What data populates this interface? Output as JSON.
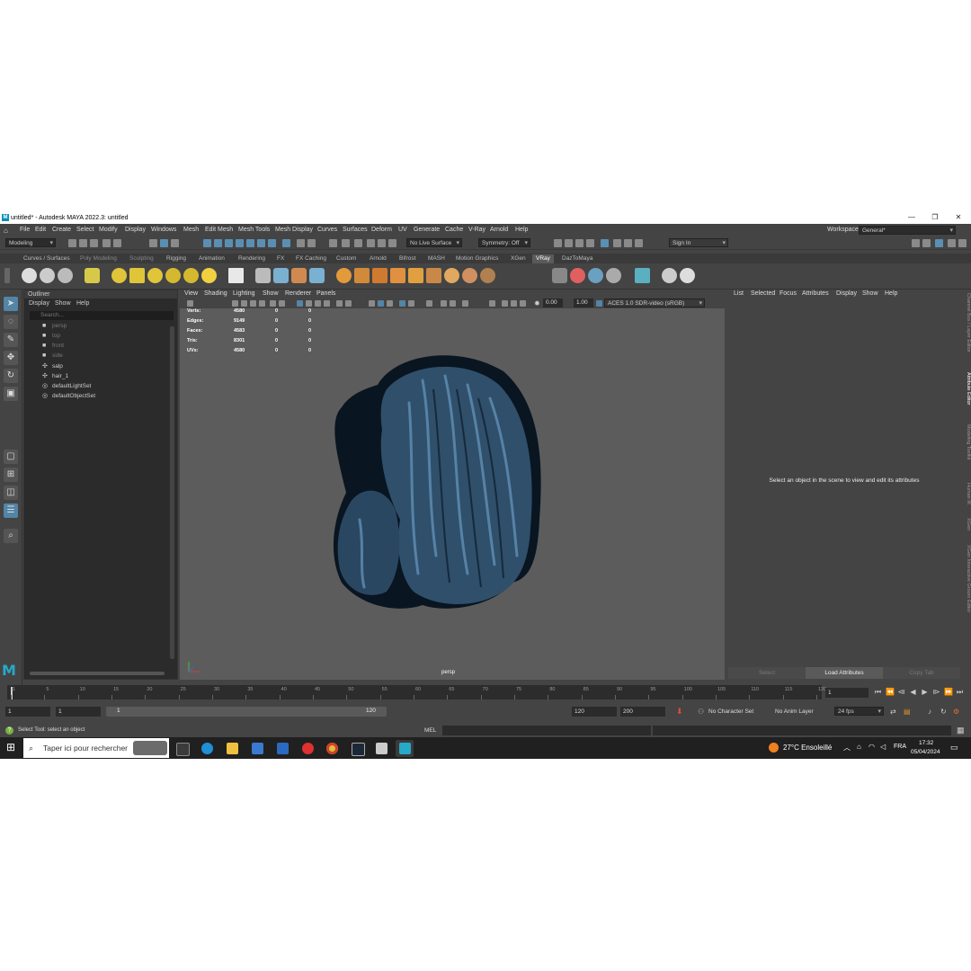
{
  "window": {
    "title": "untitled* - Autodesk MAYA 2022.3: untitled",
    "logo": "M",
    "minimize_icon": "—",
    "restore_icon": "❐",
    "close_icon": "✕"
  },
  "menubar": {
    "items": [
      "File",
      "Edit",
      "Create",
      "Select",
      "Modify",
      "Display",
      "Windows",
      "Mesh",
      "Edit Mesh",
      "Mesh Tools",
      "Mesh Display",
      "Curves",
      "Surfaces",
      "Deform",
      "UV",
      "Generate",
      "Cache",
      "V-Ray",
      "Arnold",
      "Help"
    ],
    "workspace_label": "Workspace:",
    "workspace_value": "General*"
  },
  "statusline": {
    "mode": "Modeling",
    "live_surface": "No Live Surface",
    "symmetry": "Symmetry: Off",
    "sign_in": "Sign In"
  },
  "shelf": {
    "tabs": [
      "Curves / Surfaces",
      "Poly Modeling",
      "Sculpting",
      "Rigging",
      "Animation",
      "Rendering",
      "FX",
      "FX Caching",
      "Custom",
      "Arnold",
      "Bifrost",
      "MASH",
      "Motion Graphics",
      "XGen",
      "VRay",
      "DazToMaya"
    ],
    "active_tab": "VRay"
  },
  "outliner": {
    "title": "Outliner",
    "menu": [
      "Display",
      "Show",
      "Help"
    ],
    "search_placeholder": "Search...",
    "items": [
      {
        "label": "persp",
        "dim": true,
        "icon": "camera-icon"
      },
      {
        "label": "top",
        "dim": true,
        "icon": "camera-icon"
      },
      {
        "label": "front",
        "dim": true,
        "icon": "camera-icon"
      },
      {
        "label": "side",
        "dim": true,
        "icon": "camera-icon"
      },
      {
        "label": "salp",
        "dim": false,
        "icon": "transform-icon"
      },
      {
        "label": "hair_1",
        "dim": false,
        "icon": "transform-icon"
      },
      {
        "label": "defaultLightSet",
        "dim": false,
        "icon": "set-icon"
      },
      {
        "label": "defaultObjectSet",
        "dim": false,
        "icon": "set-icon"
      }
    ]
  },
  "viewport": {
    "menu": [
      "View",
      "Shading",
      "Lighting",
      "Show",
      "Renderer",
      "Panels"
    ],
    "exposure": "0.00",
    "gamma": "1.00",
    "color_space": "ACES 1.0 SDR-video (sRGB)",
    "camera": "persp",
    "hud": [
      {
        "label": "Verts:",
        "v1": "4580",
        "v2": "0",
        "v3": "0"
      },
      {
        "label": "Edges:",
        "v1": "9149",
        "v2": "0",
        "v3": "0"
      },
      {
        "label": "Faces:",
        "v1": "4583",
        "v2": "0",
        "v3": "0"
      },
      {
        "label": "Tris:",
        "v1": "8301",
        "v2": "0",
        "v3": "0"
      },
      {
        "label": "UVs:",
        "v1": "4580",
        "v2": "0",
        "v3": "0"
      }
    ],
    "hair_color": "#3a5c7a"
  },
  "attribute_editor": {
    "menu": [
      "List",
      "Selected",
      "Focus",
      "Attributes",
      "Display",
      "Show",
      "Help"
    ],
    "message": "Select an object in the scene to view and edit its attributes",
    "buttons": [
      "Select",
      "Load Attributes",
      "Copy Tab"
    ]
  },
  "right_tabs": [
    "Channel Box / Layer Editor",
    "Attribute Editor",
    "Modeling Toolkit",
    "Human IK",
    "XGen",
    "XGen Interactive Groom Editor"
  ],
  "timeline": {
    "ticks": [
      "1",
      "5",
      "10",
      "15",
      "20",
      "25",
      "30",
      "35",
      "40",
      "45",
      "50",
      "55",
      "60",
      "65",
      "70",
      "75",
      "80",
      "85",
      "90",
      "95",
      "100",
      "105",
      "110",
      "115",
      "120"
    ],
    "current_frame": "1"
  },
  "range": {
    "start": "1",
    "anim_start": "1",
    "slider_start": "1",
    "slider_end": "120",
    "anim_end": "120",
    "end": "200",
    "character_set": "No Character Set",
    "anim_layer": "No Anim Layer",
    "fps": "24 fps"
  },
  "commandline": {
    "help_text": "Select Tool: select an object",
    "lang": "MEL"
  },
  "taskbar": {
    "search_placeholder": "Taper ici pour rechercher",
    "weather": "27°C  Ensoleillé",
    "lang": "FRA",
    "time": "17:32",
    "date": "05/04/2024"
  },
  "colors": {
    "accent": "#5285a6",
    "panel": "#444444",
    "viewport": "#5c5c5c"
  }
}
